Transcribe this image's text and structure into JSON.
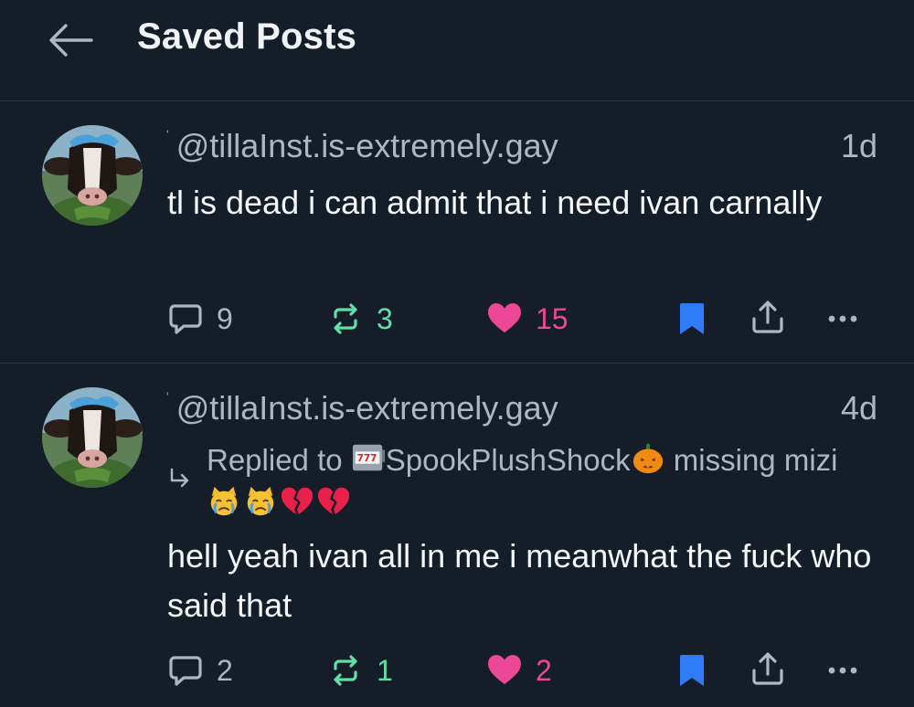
{
  "header": {
    "title": "Saved Posts",
    "back_icon": "arrow-left-icon"
  },
  "colors": {
    "background": "#151d28",
    "divider": "#2a3442",
    "muted_text": "#aeb6c1",
    "repost_green": "#5fe0a6",
    "like_pink": "#ec4899",
    "bookmark_blue": "#2f7cf6"
  },
  "posts": [
    {
      "handle": "@tillaInst.is-extremely.gay",
      "time": "1d",
      "text": "tl is dead i can admit that i need ivan carnally",
      "reply_count": "9",
      "repost_count": "3",
      "like_count": "15",
      "bookmarked": true
    },
    {
      "handle": "@tillaInst.is-extremely.gay",
      "time": "4d",
      "replied_to_prefix": "Replied to",
      "replied_to_name": "SpookPlushShock",
      "replied_to_preview": "missing mizi",
      "reply_preview_emojis": [
        "crying-cat-icon",
        "crying-cat-icon",
        "broken-heart-icon",
        "broken-heart-icon"
      ],
      "text": "hell yeah ivan all in me i meanwhat the fuck who said that",
      "reply_count": "2",
      "repost_count": "1",
      "like_count": "2",
      "bookmarked": true
    }
  ]
}
